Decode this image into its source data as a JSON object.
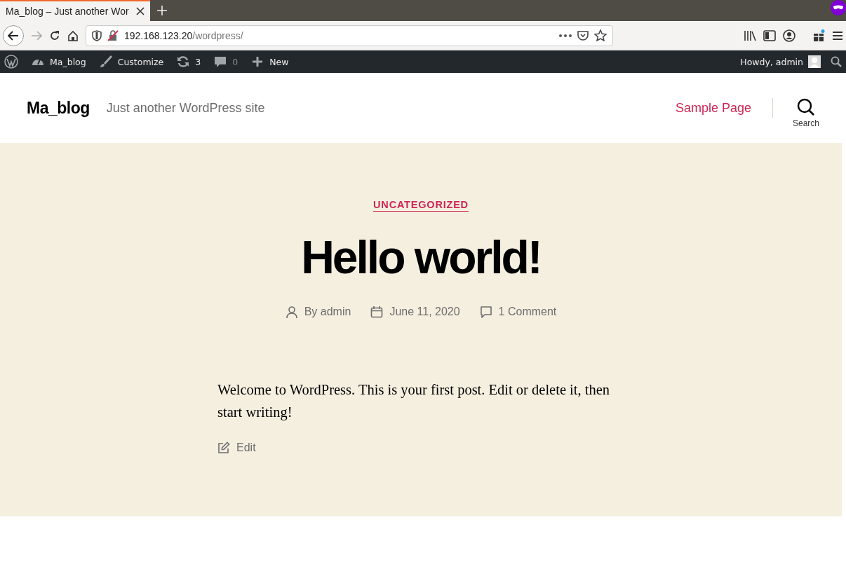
{
  "browser": {
    "tabs": [
      {
        "title": "Ma_blog – Just another Wor",
        "selected": true
      }
    ],
    "url": {
      "host": "192.168.123.20",
      "path": "/wordpress/"
    }
  },
  "admin_bar": {
    "items": [
      {
        "kind": "logo"
      },
      {
        "kind": "site",
        "label": "Ma_blog"
      },
      {
        "kind": "customize",
        "label": "Customize"
      },
      {
        "kind": "updates",
        "label": "3"
      },
      {
        "kind": "comments",
        "label": "0"
      },
      {
        "kind": "new",
        "label": "New"
      }
    ],
    "account": "Howdy, admin"
  },
  "site_header": {
    "title": "Ma_blog",
    "tagline": "Just another WordPress site",
    "nav": [
      {
        "label": "Sample Page"
      }
    ],
    "search_label": "Search"
  },
  "post": {
    "category": "UNCATEGORIZED",
    "title": "Hello world!",
    "meta": [
      {
        "kind": "author",
        "text": "By admin"
      },
      {
        "kind": "date",
        "text": "June 11, 2020"
      },
      {
        "kind": "comments",
        "text": "1 Comment"
      }
    ],
    "body": "Welcome to WordPress. This is your first post. Edit or delete it, then start writing!",
    "edit_label": "Edit"
  }
}
